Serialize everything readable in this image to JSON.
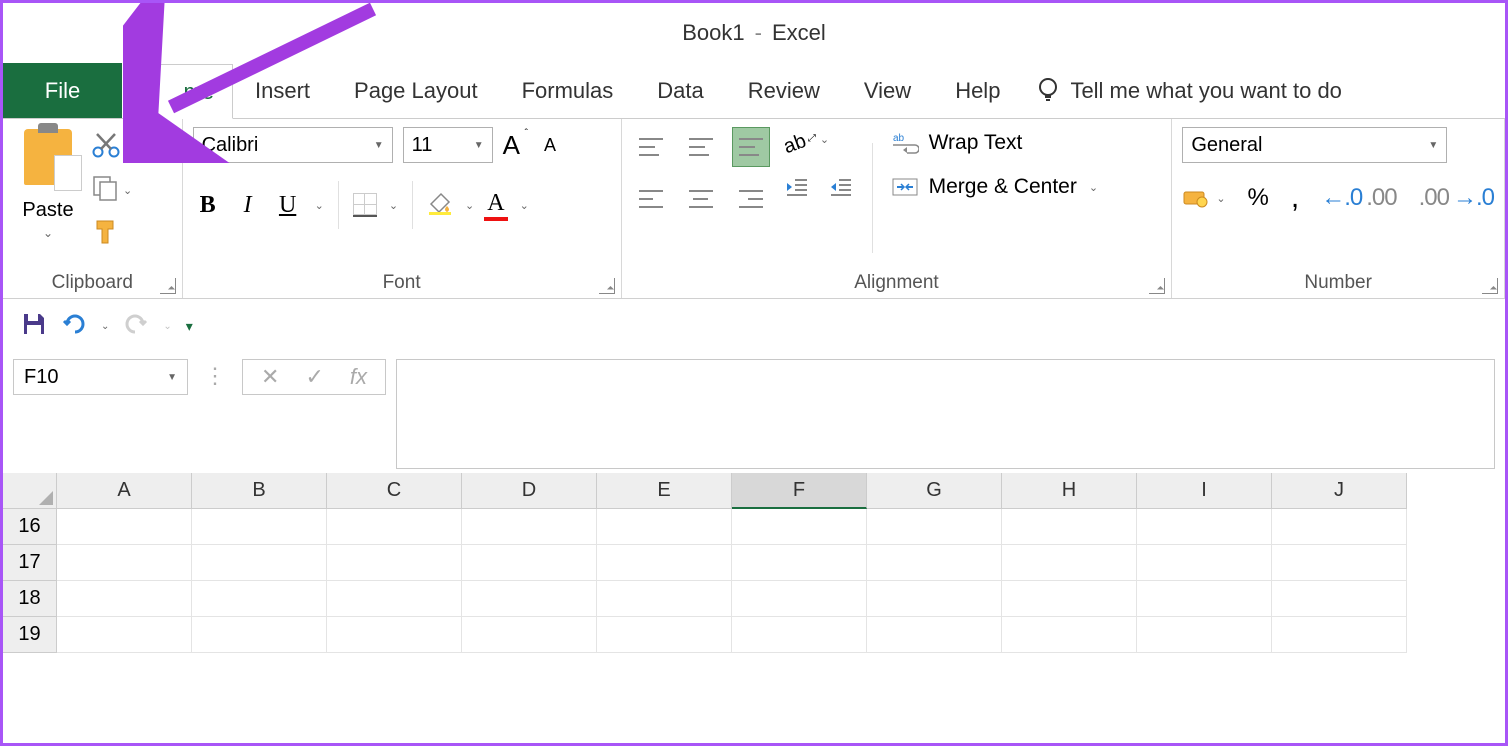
{
  "title": {
    "doc": "Book1",
    "app": "Excel"
  },
  "tabs": {
    "file": "File",
    "home_suffix": "me",
    "items": [
      "Insert",
      "Page Layout",
      "Formulas",
      "Data",
      "Review",
      "View",
      "Help"
    ],
    "tell_me": "Tell me what you want to do"
  },
  "ribbon": {
    "clipboard": {
      "paste": "Paste",
      "label": "Clipboard"
    },
    "font": {
      "name": "Calibri",
      "size": "11",
      "label": "Font"
    },
    "alignment": {
      "wrap": "Wrap Text",
      "merge": "Merge & Center",
      "label": "Alignment"
    },
    "number": {
      "format": "General",
      "label": "Number"
    }
  },
  "namebox": "F10",
  "columns": [
    "A",
    "B",
    "C",
    "D",
    "E",
    "F",
    "G",
    "H",
    "I",
    "J"
  ],
  "active_column": "F",
  "rows": [
    "16",
    "17",
    "18",
    "19"
  ]
}
